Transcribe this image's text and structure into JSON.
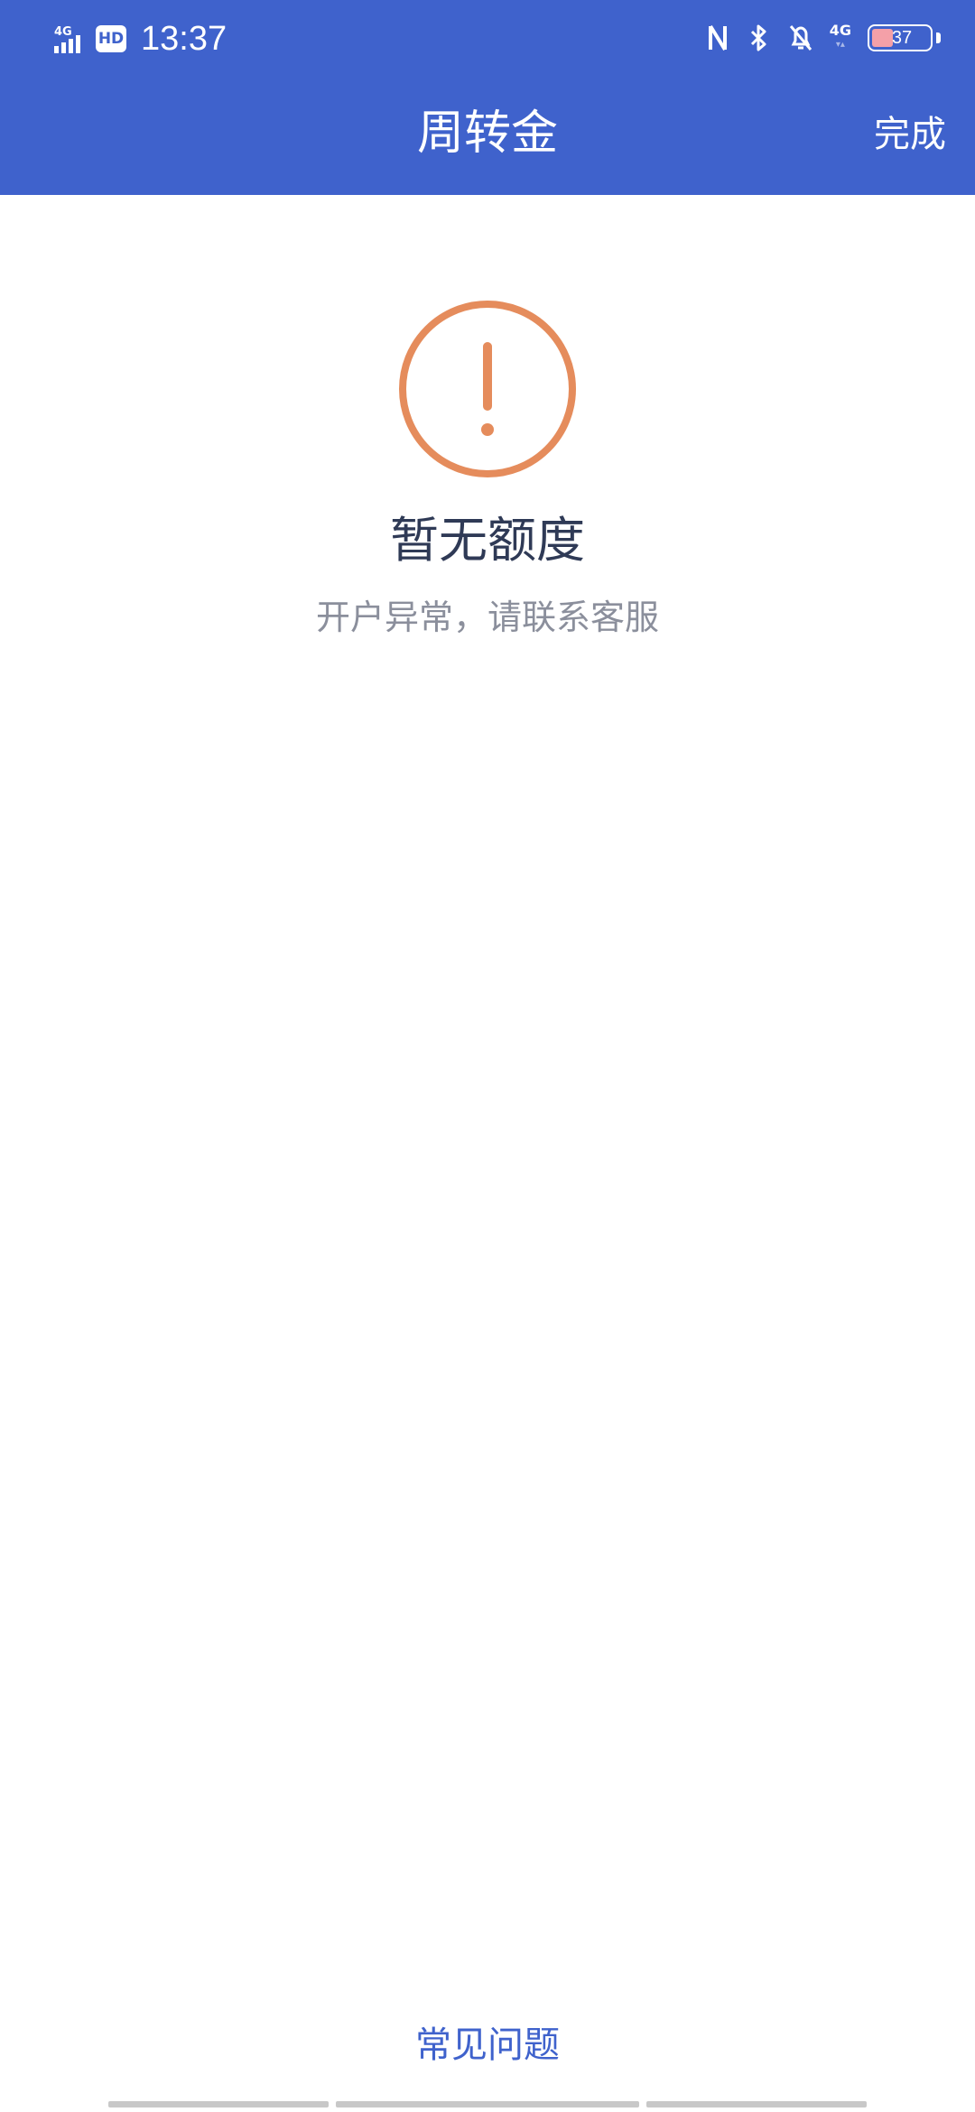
{
  "status_bar": {
    "network_left": "4G",
    "hd_label": "HD",
    "time": "13:37",
    "network_right": "4G",
    "battery_level": "37",
    "battery_fraction": 0.37
  },
  "nav": {
    "title": "周转金",
    "done_label": "完成"
  },
  "empty_state": {
    "icon": "exclamation-circle-icon",
    "title": "暂无额度",
    "subtitle": "开户异常，请联系客服"
  },
  "footer": {
    "faq_label": "常见问题"
  },
  "colors": {
    "primary": "#3f62cc",
    "warning": "#e58c5c",
    "title_text": "#2f3a56",
    "subtitle_text": "#8b8f9c"
  }
}
